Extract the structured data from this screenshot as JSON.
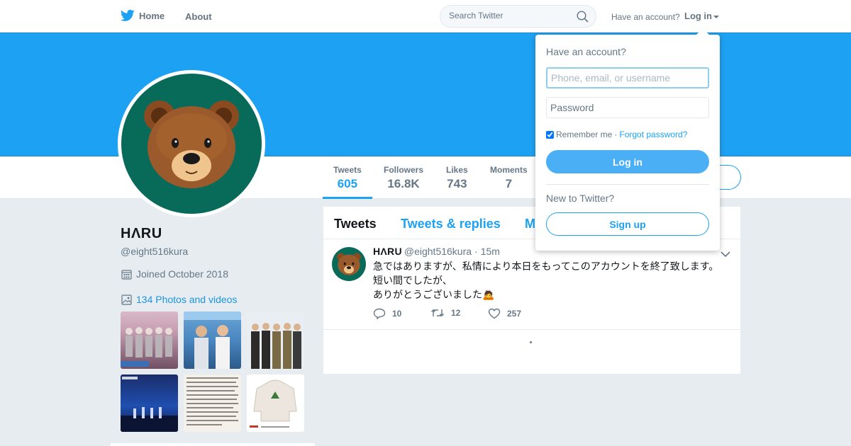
{
  "nav": {
    "home_label": "Home",
    "about_label": "About",
    "search_placeholder": "Search Twitter",
    "have_account_text": "Have an account?",
    "login_label": "Log in",
    "brand_color": "#1da1f2"
  },
  "banner": {
    "color": "#1da1f2"
  },
  "profile": {
    "avatar_emoji": "🐻",
    "avatar_bg": "#086b5a",
    "name": "HΛRU",
    "handle": "@eight516kura",
    "joined": "Joined October 2018",
    "photos_link": "134 Photos and videos"
  },
  "stats": [
    {
      "label": "Tweets",
      "value": "605",
      "active": true
    },
    {
      "label": "Followers",
      "value": "16.8K",
      "active": false
    },
    {
      "label": "Likes",
      "value": "743",
      "active": false
    },
    {
      "label": "Moments",
      "value": "7",
      "active": false
    }
  ],
  "timeline": {
    "tabs": [
      "Tweets",
      "Tweets & replies",
      "M"
    ],
    "tweet": {
      "name": "HΛRU",
      "handle": "@eight516kura",
      "time": "15m",
      "lines": [
        "急ではありますが、私情により本日をもってこのアカウントを終了致します。",
        "短い間でしたが、",
        "ありがとうございました🙇"
      ],
      "replies": "10",
      "retweets": "12",
      "likes": "257"
    }
  },
  "login_dropdown": {
    "title": "Have an account?",
    "username_placeholder": "Phone, email, or username",
    "password_placeholder": "Password",
    "remember_me": "Remember me",
    "separator": "·",
    "forgot_password": "Forgot password?",
    "login_button": "Log in",
    "new_to_twitter": "New to Twitter?",
    "signup_button": "Sign up"
  }
}
